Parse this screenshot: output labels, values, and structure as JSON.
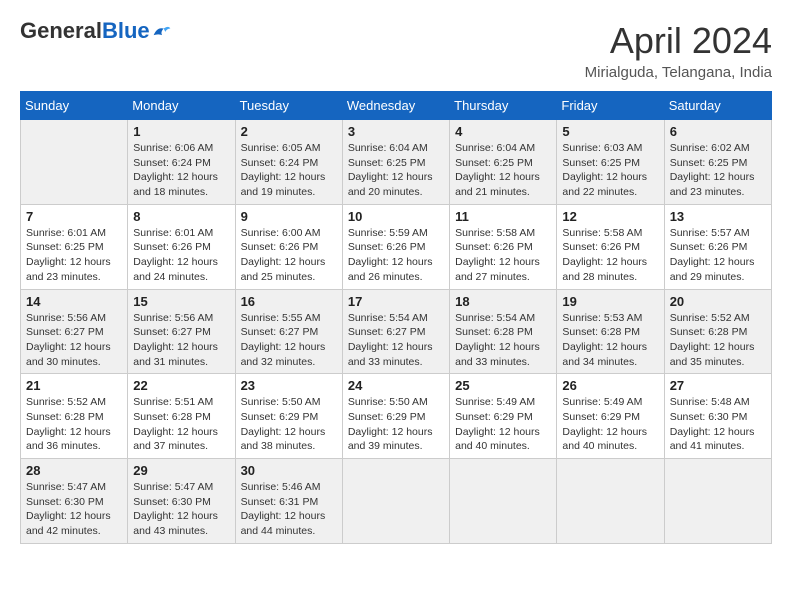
{
  "logo": {
    "general": "General",
    "blue": "Blue"
  },
  "title": "April 2024",
  "location": "Mirialguda, Telangana, India",
  "headers": [
    "Sunday",
    "Monday",
    "Tuesday",
    "Wednesday",
    "Thursday",
    "Friday",
    "Saturday"
  ],
  "weeks": [
    [
      {
        "day": "",
        "sunrise": "",
        "sunset": "",
        "daylight": ""
      },
      {
        "day": "1",
        "sunrise": "Sunrise: 6:06 AM",
        "sunset": "Sunset: 6:24 PM",
        "daylight": "Daylight: 12 hours and 18 minutes."
      },
      {
        "day": "2",
        "sunrise": "Sunrise: 6:05 AM",
        "sunset": "Sunset: 6:24 PM",
        "daylight": "Daylight: 12 hours and 19 minutes."
      },
      {
        "day": "3",
        "sunrise": "Sunrise: 6:04 AM",
        "sunset": "Sunset: 6:25 PM",
        "daylight": "Daylight: 12 hours and 20 minutes."
      },
      {
        "day": "4",
        "sunrise": "Sunrise: 6:04 AM",
        "sunset": "Sunset: 6:25 PM",
        "daylight": "Daylight: 12 hours and 21 minutes."
      },
      {
        "day": "5",
        "sunrise": "Sunrise: 6:03 AM",
        "sunset": "Sunset: 6:25 PM",
        "daylight": "Daylight: 12 hours and 22 minutes."
      },
      {
        "day": "6",
        "sunrise": "Sunrise: 6:02 AM",
        "sunset": "Sunset: 6:25 PM",
        "daylight": "Daylight: 12 hours and 23 minutes."
      }
    ],
    [
      {
        "day": "7",
        "sunrise": "Sunrise: 6:01 AM",
        "sunset": "Sunset: 6:25 PM",
        "daylight": "Daylight: 12 hours and 23 minutes."
      },
      {
        "day": "8",
        "sunrise": "Sunrise: 6:01 AM",
        "sunset": "Sunset: 6:26 PM",
        "daylight": "Daylight: 12 hours and 24 minutes."
      },
      {
        "day": "9",
        "sunrise": "Sunrise: 6:00 AM",
        "sunset": "Sunset: 6:26 PM",
        "daylight": "Daylight: 12 hours and 25 minutes."
      },
      {
        "day": "10",
        "sunrise": "Sunrise: 5:59 AM",
        "sunset": "Sunset: 6:26 PM",
        "daylight": "Daylight: 12 hours and 26 minutes."
      },
      {
        "day": "11",
        "sunrise": "Sunrise: 5:58 AM",
        "sunset": "Sunset: 6:26 PM",
        "daylight": "Daylight: 12 hours and 27 minutes."
      },
      {
        "day": "12",
        "sunrise": "Sunrise: 5:58 AM",
        "sunset": "Sunset: 6:26 PM",
        "daylight": "Daylight: 12 hours and 28 minutes."
      },
      {
        "day": "13",
        "sunrise": "Sunrise: 5:57 AM",
        "sunset": "Sunset: 6:26 PM",
        "daylight": "Daylight: 12 hours and 29 minutes."
      }
    ],
    [
      {
        "day": "14",
        "sunrise": "Sunrise: 5:56 AM",
        "sunset": "Sunset: 6:27 PM",
        "daylight": "Daylight: 12 hours and 30 minutes."
      },
      {
        "day": "15",
        "sunrise": "Sunrise: 5:56 AM",
        "sunset": "Sunset: 6:27 PM",
        "daylight": "Daylight: 12 hours and 31 minutes."
      },
      {
        "day": "16",
        "sunrise": "Sunrise: 5:55 AM",
        "sunset": "Sunset: 6:27 PM",
        "daylight": "Daylight: 12 hours and 32 minutes."
      },
      {
        "day": "17",
        "sunrise": "Sunrise: 5:54 AM",
        "sunset": "Sunset: 6:27 PM",
        "daylight": "Daylight: 12 hours and 33 minutes."
      },
      {
        "day": "18",
        "sunrise": "Sunrise: 5:54 AM",
        "sunset": "Sunset: 6:28 PM",
        "daylight": "Daylight: 12 hours and 33 minutes."
      },
      {
        "day": "19",
        "sunrise": "Sunrise: 5:53 AM",
        "sunset": "Sunset: 6:28 PM",
        "daylight": "Daylight: 12 hours and 34 minutes."
      },
      {
        "day": "20",
        "sunrise": "Sunrise: 5:52 AM",
        "sunset": "Sunset: 6:28 PM",
        "daylight": "Daylight: 12 hours and 35 minutes."
      }
    ],
    [
      {
        "day": "21",
        "sunrise": "Sunrise: 5:52 AM",
        "sunset": "Sunset: 6:28 PM",
        "daylight": "Daylight: 12 hours and 36 minutes."
      },
      {
        "day": "22",
        "sunrise": "Sunrise: 5:51 AM",
        "sunset": "Sunset: 6:28 PM",
        "daylight": "Daylight: 12 hours and 37 minutes."
      },
      {
        "day": "23",
        "sunrise": "Sunrise: 5:50 AM",
        "sunset": "Sunset: 6:29 PM",
        "daylight": "Daylight: 12 hours and 38 minutes."
      },
      {
        "day": "24",
        "sunrise": "Sunrise: 5:50 AM",
        "sunset": "Sunset: 6:29 PM",
        "daylight": "Daylight: 12 hours and 39 minutes."
      },
      {
        "day": "25",
        "sunrise": "Sunrise: 5:49 AM",
        "sunset": "Sunset: 6:29 PM",
        "daylight": "Daylight: 12 hours and 40 minutes."
      },
      {
        "day": "26",
        "sunrise": "Sunrise: 5:49 AM",
        "sunset": "Sunset: 6:29 PM",
        "daylight": "Daylight: 12 hours and 40 minutes."
      },
      {
        "day": "27",
        "sunrise": "Sunrise: 5:48 AM",
        "sunset": "Sunset: 6:30 PM",
        "daylight": "Daylight: 12 hours and 41 minutes."
      }
    ],
    [
      {
        "day": "28",
        "sunrise": "Sunrise: 5:47 AM",
        "sunset": "Sunset: 6:30 PM",
        "daylight": "Daylight: 12 hours and 42 minutes."
      },
      {
        "day": "29",
        "sunrise": "Sunrise: 5:47 AM",
        "sunset": "Sunset: 6:30 PM",
        "daylight": "Daylight: 12 hours and 43 minutes."
      },
      {
        "day": "30",
        "sunrise": "Sunrise: 5:46 AM",
        "sunset": "Sunset: 6:31 PM",
        "daylight": "Daylight: 12 hours and 44 minutes."
      },
      {
        "day": "",
        "sunrise": "",
        "sunset": "",
        "daylight": ""
      },
      {
        "day": "",
        "sunrise": "",
        "sunset": "",
        "daylight": ""
      },
      {
        "day": "",
        "sunrise": "",
        "sunset": "",
        "daylight": ""
      },
      {
        "day": "",
        "sunrise": "",
        "sunset": "",
        "daylight": ""
      }
    ]
  ]
}
